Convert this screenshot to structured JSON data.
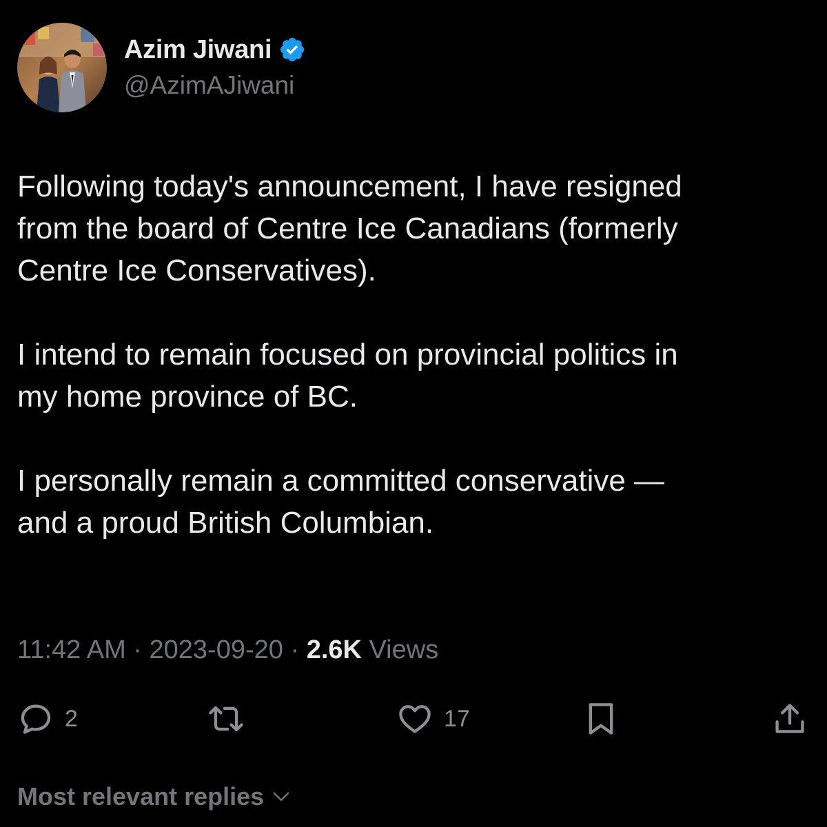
{
  "author": {
    "name": "Azim Jiwani",
    "handle": "@AzimAJiwani",
    "verified_icon": "verified-badge-icon",
    "avatar_icon": "avatar-photo"
  },
  "tweet": {
    "paragraphs": [
      "Following today's announcement, I have resigned\nfrom the board of Centre Ice Canadians (formerly\nCentre Ice Conservatives).",
      "I intend to remain focused on provincial politics in\nmy home province of BC.",
      "I personally remain a committed conservative —\nand a proud British Columbian."
    ]
  },
  "meta": {
    "time": "11:42 AM",
    "separator": " · ",
    "date": "2023-09-20",
    "views_count": "2.6K",
    "views_label": " Views"
  },
  "actions": {
    "reply": {
      "icon": "reply-icon",
      "count": "2"
    },
    "repost": {
      "icon": "repost-icon",
      "count": ""
    },
    "like": {
      "icon": "heart-icon",
      "count": "17"
    },
    "bookmark": {
      "icon": "bookmark-icon"
    },
    "share": {
      "icon": "share-icon"
    }
  },
  "replies": {
    "sort_label": "Most relevant replies",
    "sort_icon": "chevron-down-icon"
  },
  "colors": {
    "background": "#000000",
    "text_primary": "#e7e9ea",
    "text_secondary": "#71767b",
    "verified_blue": "#1d9bf0"
  }
}
